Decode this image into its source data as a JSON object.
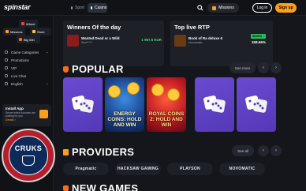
{
  "header": {
    "logo_text": "spinstar",
    "nav": {
      "sport": "Sport",
      "casino": "Casino"
    },
    "missions": "Missions",
    "login": "Log in",
    "signup": "Sign up"
  },
  "sidebar": {
    "tiles": {
      "wheel": "Wheel",
      "missions": "Missions",
      "store": "Store",
      "big_win": "Big Win"
    },
    "items": [
      {
        "label": "Game Categories",
        "icon": "grid-icon",
        "chevron": "⌄"
      },
      {
        "label": "Promotions",
        "icon": "gift-icon"
      },
      {
        "label": "VIP",
        "icon": "crown-icon"
      },
      {
        "label": "Live Chat",
        "icon": "chat-icon"
      },
      {
        "label": "English",
        "icon": "globe-icon",
        "chevron": "⌄"
      }
    ],
    "install": {
      "title": "Install App",
      "subtitle": "Secret extra bonuses are waiting for you",
      "details": "Details ›"
    },
    "seal_text": "CRUKS"
  },
  "winners": {
    "title": "Winners Of the day",
    "game": "Wanted Dead or a Wild",
    "user": "Sen*****",
    "amount": "1 987.6 EUR"
  },
  "top_rtp": {
    "title": "Top live RTP",
    "game": "Book of Ra deluxe 6",
    "provider": "Novomatic",
    "badge": "35.00% ↑",
    "value": "158.66%"
  },
  "popular": {
    "title": "POPULAR",
    "see_more": "See more",
    "prev": "‹",
    "next": "›",
    "games": [
      {
        "type": "dice",
        "title": ""
      },
      {
        "type": "coins",
        "title": "ENERGY COINS: HOLD AND WIN"
      },
      {
        "type": "royal",
        "title": "ROYAL COINS 2: HOLD AND WIN"
      },
      {
        "type": "dice",
        "title": ""
      },
      {
        "type": "dice",
        "title": ""
      }
    ]
  },
  "providers": {
    "title": "PROVIDERS",
    "see_all": "See all",
    "prev": "‹",
    "next": "›",
    "list": [
      "Pragmatic",
      "HACKSAW GAMING",
      "PLAYSON",
      "NOVOMATIC"
    ]
  },
  "new_games": {
    "title": "NEW GAMES"
  },
  "colors": {
    "accent": "#ff9e1b",
    "background": "#14161c",
    "panel": "#1d2027",
    "win_green": "#3ddc84"
  }
}
